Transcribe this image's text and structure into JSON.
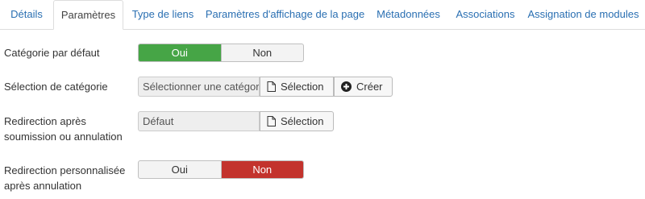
{
  "tabs": [
    {
      "label": "Détails",
      "active": false
    },
    {
      "label": "Paramètres",
      "active": true
    },
    {
      "label": "Type de liens",
      "active": false
    },
    {
      "label": "Paramètres d'affichage de la page",
      "active": false
    },
    {
      "label": "Métadonnées",
      "active": false
    },
    {
      "label": "Associations",
      "active": false
    },
    {
      "label": "Assignation de modules",
      "active": false
    }
  ],
  "fields": {
    "default_category": {
      "label": "Catégorie par défaut",
      "yes": "Oui",
      "no": "Non",
      "selected": "Oui"
    },
    "category_select": {
      "label": "Sélection de catégorie",
      "value": "Sélectionner une catégorie",
      "select_button": "Sélection",
      "create_button": "Créer"
    },
    "redirect": {
      "label_line1": "Redirection après",
      "label_line2": "soumission ou annulation",
      "value": "Défaut",
      "select_button": "Sélection"
    },
    "custom_redirect": {
      "label_line1": "Redirection personnalisée",
      "label_line2": "après annulation",
      "yes": "Oui",
      "no": "Non",
      "selected": "Non"
    }
  },
  "colors": {
    "link": "#2a6fb2",
    "yes_active": "#46a546",
    "no_active": "#c3332d"
  }
}
